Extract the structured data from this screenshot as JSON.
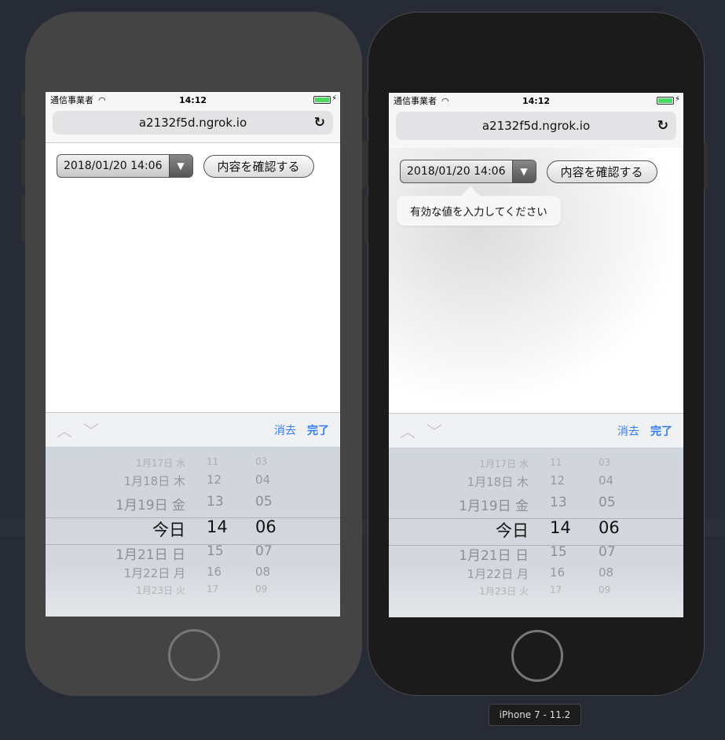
{
  "device_label": "iPhone 7 - 11.2",
  "status": {
    "carrier": "通信事業者",
    "time": "14:12"
  },
  "browser": {
    "url": "a2132f5d.ngrok.io"
  },
  "form": {
    "datetime_value": "2018/01/20 14:06",
    "submit_label": "内容を確認する"
  },
  "validation_message": "有効な値を入力してください",
  "accessory": {
    "clear_label": "消去",
    "done_label": "完了"
  },
  "picker": {
    "rows": [
      {
        "date": "1月17日 水",
        "hour": "11",
        "minute": "03"
      },
      {
        "date": "1月18日 木",
        "hour": "12",
        "minute": "04"
      },
      {
        "date": "1月19日 金",
        "hour": "13",
        "minute": "05"
      },
      {
        "date": "今日",
        "hour": "14",
        "minute": "06",
        "selected": true
      },
      {
        "date": "1月21日 日",
        "hour": "15",
        "minute": "07"
      },
      {
        "date": "1月22日 月",
        "hour": "16",
        "minute": "08"
      },
      {
        "date": "1月23日 火",
        "hour": "17",
        "minute": "09"
      }
    ]
  },
  "colors": {
    "accent": "#2f7cf6",
    "battery": "#4cd964"
  }
}
